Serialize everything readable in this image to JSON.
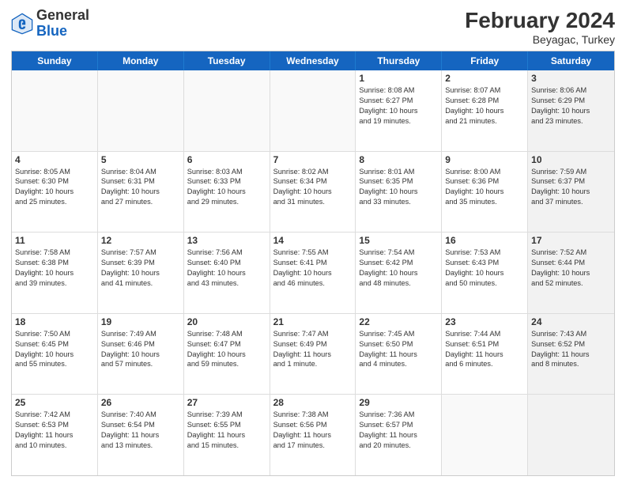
{
  "header": {
    "logo": {
      "general": "General",
      "blue": "Blue"
    },
    "title": "February 2024",
    "location": "Beyagac, Turkey"
  },
  "calendar": {
    "days_of_week": [
      "Sunday",
      "Monday",
      "Tuesday",
      "Wednesday",
      "Thursday",
      "Friday",
      "Saturday"
    ],
    "rows": [
      [
        {
          "day": "",
          "info": "",
          "empty": true
        },
        {
          "day": "",
          "info": "",
          "empty": true
        },
        {
          "day": "",
          "info": "",
          "empty": true
        },
        {
          "day": "",
          "info": "",
          "empty": true
        },
        {
          "day": "1",
          "info": "Sunrise: 8:08 AM\nSunset: 6:27 PM\nDaylight: 10 hours\nand 19 minutes.",
          "empty": false
        },
        {
          "day": "2",
          "info": "Sunrise: 8:07 AM\nSunset: 6:28 PM\nDaylight: 10 hours\nand 21 minutes.",
          "empty": false
        },
        {
          "day": "3",
          "info": "Sunrise: 8:06 AM\nSunset: 6:29 PM\nDaylight: 10 hours\nand 23 minutes.",
          "empty": false,
          "shaded": true
        }
      ],
      [
        {
          "day": "4",
          "info": "Sunrise: 8:05 AM\nSunset: 6:30 PM\nDaylight: 10 hours\nand 25 minutes.",
          "empty": false
        },
        {
          "day": "5",
          "info": "Sunrise: 8:04 AM\nSunset: 6:31 PM\nDaylight: 10 hours\nand 27 minutes.",
          "empty": false
        },
        {
          "day": "6",
          "info": "Sunrise: 8:03 AM\nSunset: 6:33 PM\nDaylight: 10 hours\nand 29 minutes.",
          "empty": false
        },
        {
          "day": "7",
          "info": "Sunrise: 8:02 AM\nSunset: 6:34 PM\nDaylight: 10 hours\nand 31 minutes.",
          "empty": false
        },
        {
          "day": "8",
          "info": "Sunrise: 8:01 AM\nSunset: 6:35 PM\nDaylight: 10 hours\nand 33 minutes.",
          "empty": false
        },
        {
          "day": "9",
          "info": "Sunrise: 8:00 AM\nSunset: 6:36 PM\nDaylight: 10 hours\nand 35 minutes.",
          "empty": false
        },
        {
          "day": "10",
          "info": "Sunrise: 7:59 AM\nSunset: 6:37 PM\nDaylight: 10 hours\nand 37 minutes.",
          "empty": false,
          "shaded": true
        }
      ],
      [
        {
          "day": "11",
          "info": "Sunrise: 7:58 AM\nSunset: 6:38 PM\nDaylight: 10 hours\nand 39 minutes.",
          "empty": false
        },
        {
          "day": "12",
          "info": "Sunrise: 7:57 AM\nSunset: 6:39 PM\nDaylight: 10 hours\nand 41 minutes.",
          "empty": false
        },
        {
          "day": "13",
          "info": "Sunrise: 7:56 AM\nSunset: 6:40 PM\nDaylight: 10 hours\nand 43 minutes.",
          "empty": false
        },
        {
          "day": "14",
          "info": "Sunrise: 7:55 AM\nSunset: 6:41 PM\nDaylight: 10 hours\nand 46 minutes.",
          "empty": false
        },
        {
          "day": "15",
          "info": "Sunrise: 7:54 AM\nSunset: 6:42 PM\nDaylight: 10 hours\nand 48 minutes.",
          "empty": false
        },
        {
          "day": "16",
          "info": "Sunrise: 7:53 AM\nSunset: 6:43 PM\nDaylight: 10 hours\nand 50 minutes.",
          "empty": false
        },
        {
          "day": "17",
          "info": "Sunrise: 7:52 AM\nSunset: 6:44 PM\nDaylight: 10 hours\nand 52 minutes.",
          "empty": false,
          "shaded": true
        }
      ],
      [
        {
          "day": "18",
          "info": "Sunrise: 7:50 AM\nSunset: 6:45 PM\nDaylight: 10 hours\nand 55 minutes.",
          "empty": false
        },
        {
          "day": "19",
          "info": "Sunrise: 7:49 AM\nSunset: 6:46 PM\nDaylight: 10 hours\nand 57 minutes.",
          "empty": false
        },
        {
          "day": "20",
          "info": "Sunrise: 7:48 AM\nSunset: 6:47 PM\nDaylight: 10 hours\nand 59 minutes.",
          "empty": false
        },
        {
          "day": "21",
          "info": "Sunrise: 7:47 AM\nSunset: 6:49 PM\nDaylight: 11 hours\nand 1 minute.",
          "empty": false
        },
        {
          "day": "22",
          "info": "Sunrise: 7:45 AM\nSunset: 6:50 PM\nDaylight: 11 hours\nand 4 minutes.",
          "empty": false
        },
        {
          "day": "23",
          "info": "Sunrise: 7:44 AM\nSunset: 6:51 PM\nDaylight: 11 hours\nand 6 minutes.",
          "empty": false
        },
        {
          "day": "24",
          "info": "Sunrise: 7:43 AM\nSunset: 6:52 PM\nDaylight: 11 hours\nand 8 minutes.",
          "empty": false,
          "shaded": true
        }
      ],
      [
        {
          "day": "25",
          "info": "Sunrise: 7:42 AM\nSunset: 6:53 PM\nDaylight: 11 hours\nand 10 minutes.",
          "empty": false
        },
        {
          "day": "26",
          "info": "Sunrise: 7:40 AM\nSunset: 6:54 PM\nDaylight: 11 hours\nand 13 minutes.",
          "empty": false
        },
        {
          "day": "27",
          "info": "Sunrise: 7:39 AM\nSunset: 6:55 PM\nDaylight: 11 hours\nand 15 minutes.",
          "empty": false
        },
        {
          "day": "28",
          "info": "Sunrise: 7:38 AM\nSunset: 6:56 PM\nDaylight: 11 hours\nand 17 minutes.",
          "empty": false
        },
        {
          "day": "29",
          "info": "Sunrise: 7:36 AM\nSunset: 6:57 PM\nDaylight: 11 hours\nand 20 minutes.",
          "empty": false
        },
        {
          "day": "",
          "info": "",
          "empty": true
        },
        {
          "day": "",
          "info": "",
          "empty": true,
          "shaded": true
        }
      ]
    ]
  }
}
